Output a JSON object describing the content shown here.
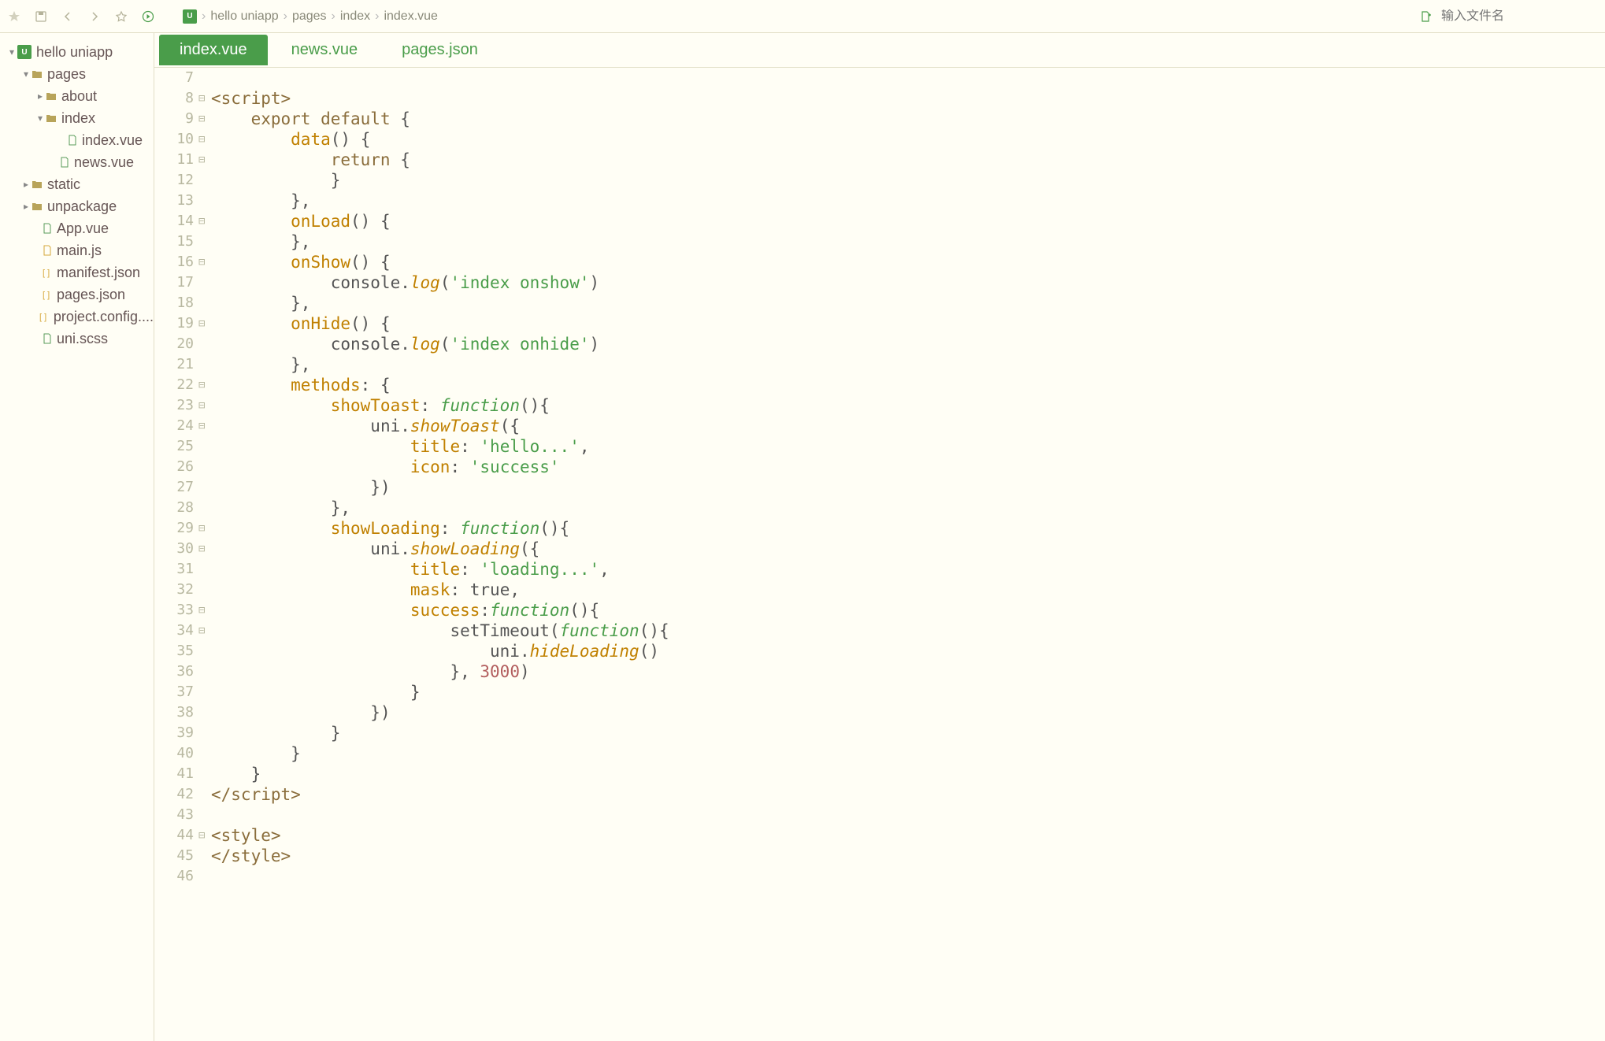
{
  "topbar": {
    "breadcrumb": [
      "hello uniapp",
      "pages",
      "index",
      "index.vue"
    ],
    "search_placeholder": "输入文件名"
  },
  "sidebar": {
    "items": [
      {
        "pad": 8,
        "chev": "▾",
        "icon": "project",
        "label": "hello uniapp"
      },
      {
        "pad": 26,
        "chev": "▾",
        "icon": "folder",
        "label": "pages"
      },
      {
        "pad": 44,
        "chev": "▸",
        "icon": "folder",
        "label": "about"
      },
      {
        "pad": 44,
        "chev": "▾",
        "icon": "folder",
        "label": "index"
      },
      {
        "pad": 72,
        "chev": "",
        "icon": "file",
        "label": "index.vue"
      },
      {
        "pad": 62,
        "chev": "",
        "icon": "file",
        "label": "news.vue"
      },
      {
        "pad": 26,
        "chev": "▸",
        "icon": "folder",
        "label": "static"
      },
      {
        "pad": 26,
        "chev": "▸",
        "icon": "folder",
        "label": "unpackage"
      },
      {
        "pad": 40,
        "chev": "",
        "icon": "file",
        "label": "App.vue"
      },
      {
        "pad": 40,
        "chev": "",
        "icon": "file-js",
        "label": "main.js"
      },
      {
        "pad": 40,
        "chev": "",
        "icon": "file-json",
        "label": "manifest.json"
      },
      {
        "pad": 40,
        "chev": "",
        "icon": "file-json",
        "label": "pages.json"
      },
      {
        "pad": 40,
        "chev": "",
        "icon": "file-json",
        "label": "project.config...."
      },
      {
        "pad": 40,
        "chev": "",
        "icon": "file",
        "label": "uni.scss"
      }
    ]
  },
  "tabs": [
    {
      "label": "index.vue",
      "active": true
    },
    {
      "label": "news.vue",
      "active": false
    },
    {
      "label": "pages.json",
      "active": false
    }
  ],
  "code": {
    "lines": [
      {
        "n": 7,
        "fold": "",
        "html": " "
      },
      {
        "n": 8,
        "fold": "⊟",
        "html": "<span class='tok-tag'>&lt;script&gt;</span>"
      },
      {
        "n": 9,
        "fold": "⊟",
        "html": "    <span class='tok-kw'>export</span> <span class='tok-kw'>default</span> <span class='tok-punc'>{</span>"
      },
      {
        "n": 10,
        "fold": "⊟",
        "html": "        <span class='tok-prop'>data</span><span class='tok-punc'>()</span> <span class='tok-punc'>{</span>"
      },
      {
        "n": 11,
        "fold": "⊟",
        "html": "            <span class='tok-kw'>return</span> <span class='tok-punc'>{</span>"
      },
      {
        "n": 12,
        "fold": "",
        "html": "            <span class='tok-punc'>}</span>"
      },
      {
        "n": 13,
        "fold": "",
        "html": "        <span class='tok-punc'>},</span>"
      },
      {
        "n": 14,
        "fold": "⊟",
        "html": "        <span class='tok-prop'>onLoad</span><span class='tok-punc'>()</span> <span class='tok-punc'>{</span>"
      },
      {
        "n": 15,
        "fold": "",
        "html": "        <span class='tok-punc'>},</span>"
      },
      {
        "n": 16,
        "fold": "⊟",
        "html": "        <span class='tok-prop'>onShow</span><span class='tok-punc'>()</span> <span class='tok-punc'>{</span>"
      },
      {
        "n": 17,
        "fold": "",
        "html": "            <span class='tok-ident'>console</span><span class='tok-punc'>.</span><span class='tok-method'>log</span><span class='tok-punc'>(</span><span class='tok-str'>'index onshow'</span><span class='tok-punc'>)</span>"
      },
      {
        "n": 18,
        "fold": "",
        "html": "        <span class='tok-punc'>},</span>"
      },
      {
        "n": 19,
        "fold": "⊟",
        "html": "        <span class='tok-prop'>onHide</span><span class='tok-punc'>()</span> <span class='tok-punc'>{</span>"
      },
      {
        "n": 20,
        "fold": "",
        "html": "            <span class='tok-ident'>console</span><span class='tok-punc'>.</span><span class='tok-method'>log</span><span class='tok-punc'>(</span><span class='tok-str'>'index onhide'</span><span class='tok-punc'>)</span>"
      },
      {
        "n": 21,
        "fold": "",
        "html": "        <span class='tok-punc'>},</span>"
      },
      {
        "n": 22,
        "fold": "⊟",
        "html": "        <span class='tok-prop'>methods</span><span class='tok-punc'>:</span> <span class='tok-punc'>{</span>"
      },
      {
        "n": 23,
        "fold": "⊟",
        "html": "            <span class='tok-prop'>showToast</span><span class='tok-punc'>:</span> <span class='tok-func'>function</span><span class='tok-punc'>(){</span>"
      },
      {
        "n": 24,
        "fold": "⊟",
        "html": "                <span class='tok-ident'>uni</span><span class='tok-punc'>.</span><span class='tok-method'>showToast</span><span class='tok-punc'>({</span>"
      },
      {
        "n": 25,
        "fold": "",
        "html": "                    <span class='tok-prop'>title</span><span class='tok-punc'>:</span> <span class='tok-str'>'hello...'</span><span class='tok-punc'>,</span>"
      },
      {
        "n": 26,
        "fold": "",
        "html": "                    <span class='tok-prop'>icon</span><span class='tok-punc'>:</span> <span class='tok-str'>'success'</span>"
      },
      {
        "n": 27,
        "fold": "",
        "html": "                <span class='tok-punc'>})</span>"
      },
      {
        "n": 28,
        "fold": "",
        "html": "            <span class='tok-punc'>},</span>"
      },
      {
        "n": 29,
        "fold": "⊟",
        "html": "            <span class='tok-prop'>showLoading</span><span class='tok-punc'>:</span> <span class='tok-func'>function</span><span class='tok-punc'>(){</span>"
      },
      {
        "n": 30,
        "fold": "⊟",
        "html": "                <span class='tok-ident'>uni</span><span class='tok-punc'>.</span><span class='tok-method'>showLoading</span><span class='tok-punc'>({</span>"
      },
      {
        "n": 31,
        "fold": "",
        "html": "                    <span class='tok-prop'>title</span><span class='tok-punc'>:</span> <span class='tok-str'>'loading...'</span><span class='tok-punc'>,</span>"
      },
      {
        "n": 32,
        "fold": "",
        "html": "                    <span class='tok-prop'>mask</span><span class='tok-punc'>:</span> <span class='tok-ident'>true</span><span class='tok-punc'>,</span>"
      },
      {
        "n": 33,
        "fold": "⊟",
        "html": "                    <span class='tok-prop'>success</span><span class='tok-punc'>:</span><span class='tok-func'>function</span><span class='tok-punc'>(){</span>"
      },
      {
        "n": 34,
        "fold": "⊟",
        "html": "                        <span class='tok-ident'>setTimeout</span><span class='tok-punc'>(</span><span class='tok-func'>function</span><span class='tok-punc'>(){</span>"
      },
      {
        "n": 35,
        "fold": "",
        "html": "                            <span class='tok-ident'>uni</span><span class='tok-punc'>.</span><span class='tok-method'>hideLoading</span><span class='tok-punc'>()</span>"
      },
      {
        "n": 36,
        "fold": "",
        "html": "                        <span class='tok-punc'>},</span> <span class='tok-num'>3000</span><span class='tok-punc'>)</span>"
      },
      {
        "n": 37,
        "fold": "",
        "html": "                    <span class='tok-punc'>}</span>"
      },
      {
        "n": 38,
        "fold": "",
        "html": "                <span class='tok-punc'>})</span>"
      },
      {
        "n": 39,
        "fold": "",
        "html": "            <span class='tok-punc'>}</span>"
      },
      {
        "n": 40,
        "fold": "",
        "html": "        <span class='tok-punc'>}</span>"
      },
      {
        "n": 41,
        "fold": "",
        "html": "    <span class='tok-punc'>}</span>"
      },
      {
        "n": 42,
        "fold": "",
        "html": "<span class='tok-tag'>&lt;/script&gt;</span>"
      },
      {
        "n": 43,
        "fold": "",
        "html": " "
      },
      {
        "n": 44,
        "fold": "⊟",
        "html": "<span class='tok-tag'>&lt;style&gt;</span>"
      },
      {
        "n": 45,
        "fold": "",
        "html": "<span class='tok-tag'>&lt;/style&gt;</span>"
      },
      {
        "n": 46,
        "fold": "",
        "html": " "
      }
    ]
  }
}
